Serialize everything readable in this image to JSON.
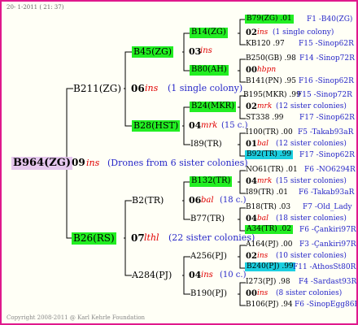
{
  "header": {
    "date": "20-  1-2011 ( 21: 37)",
    "copyright": "Copyright 2008-2011 @ Karl Kehrle Foundation"
  },
  "root": {
    "id": "B964(ZG)",
    "year": "09",
    "breeder": "ins",
    "note": "(Drones from 6 sister colonies)"
  },
  "gen1": [
    {
      "id": "B211(ZG)",
      "year": "06",
      "breeder": "ins",
      "note": "(1 single colony)"
    },
    {
      "id": "B26(RS)",
      "year": "07",
      "breeder": "lthl",
      "note": "(22 sister colonies)"
    }
  ],
  "gen2": [
    {
      "id": "B45(ZG)",
      "year": "03",
      "breeder": "ins",
      "note": ""
    },
    {
      "id": "B28(HST)",
      "year": "04",
      "breeder": "mrk",
      "note": "(15 c.)"
    },
    {
      "id": "B2(TR)",
      "year": "06",
      "breeder": "bal",
      "note": "(18 c.)"
    },
    {
      "id": "A284(PJ)",
      "year": "04",
      "breeder": "ins",
      "note": "(10 c.)"
    }
  ],
  "gen3": [
    "B14(ZG)",
    "B80(AH)",
    "B24(MKR)",
    "I89(TR)",
    "B132(TR)",
    "B77(TR)",
    "A256(PJ)",
    "B190(PJ)"
  ],
  "gen4": [
    {
      "left": "B79(ZG) .01",
      "right": "F1 -B40(ZG)"
    },
    {
      "year": "02",
      "breeder": "ins",
      "note": "(1 single colony)"
    },
    {
      "left": "KB120 .97",
      "right": "F15 -Sinop62R"
    },
    {
      "left": "B250(GB) .98",
      "right": "F14 -Sinop72R"
    },
    {
      "year": "00",
      "breeder": "hbpn",
      "note": ""
    },
    {
      "left": "B141(PN) .95",
      "right": "F16 -Sinop62R"
    },
    {
      "left": "B195(MKR) .99",
      "right": "F15 -Sinop72R"
    },
    {
      "year": "02",
      "breeder": "mrk",
      "note": "(12 sister colonies)"
    },
    {
      "left": "ST338 .99",
      "right": "F17 -Sinop62R"
    },
    {
      "left": "I100(TR) .00",
      "right": "F5 -Takab93aR"
    },
    {
      "year": "01",
      "breeder": "bal",
      "note": "(12 sister colonies)"
    },
    {
      "left": "B92(TR) .99",
      "right": "F17 -Sinop62R"
    },
    {
      "left": "NO61(TR) .01",
      "right": "F6 -NO6294R"
    },
    {
      "year": "04",
      "breeder": "mrk",
      "note": "(15 sister colonies)"
    },
    {
      "left": "I89(TR) .01",
      "right": "F6 -Takab93aR"
    },
    {
      "left": "B18(TR) .03",
      "right": "F7 -Old_Lady"
    },
    {
      "year": "04",
      "breeder": "bal",
      "note": "(18 sister colonies)"
    },
    {
      "left": "A34(TR) .02",
      "right": "F6 -Çankiri97R"
    },
    {
      "left": "A164(PJ) .00",
      "right": "F3 -Çankiri97R"
    },
    {
      "year": "02",
      "breeder": "ins",
      "note": "(10 sister colonies)"
    },
    {
      "left": "B240(PJ) .99",
      "right": "F11 -AthosSt80R"
    },
    {
      "left": "I273(PJ) .98",
      "right": "F4 -Sardast93R"
    },
    {
      "year": "00",
      "breeder": "ins",
      "note": "(8 sister colonies)"
    },
    {
      "left": "B106(PJ) .94",
      "right": "F6 -SinopEgg86R"
    }
  ],
  "colors": {
    "border": "#e0188c",
    "green": "#22ee22",
    "cyan": "#1ccfe0",
    "pink": "#e6c8ee",
    "red": "#e00000",
    "blue": "#2626c8"
  }
}
